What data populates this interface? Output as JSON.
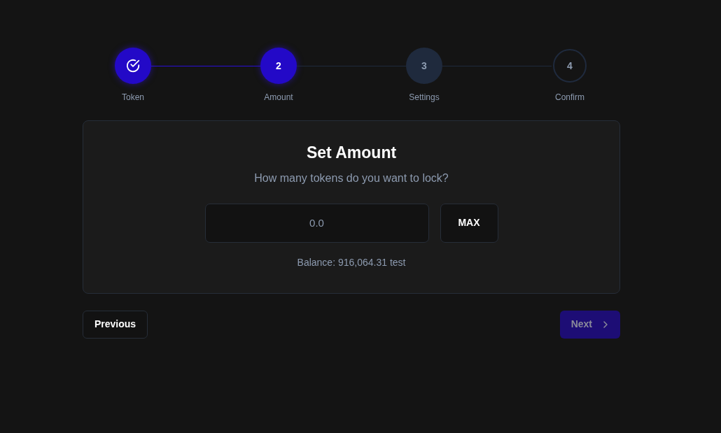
{
  "steps": [
    {
      "label": "Token",
      "kind": "done"
    },
    {
      "label": "Amount",
      "number": "2",
      "kind": "current"
    },
    {
      "label": "Settings",
      "number": "3",
      "kind": "next"
    },
    {
      "label": "Confirm",
      "number": "4",
      "kind": "pending"
    }
  ],
  "card": {
    "title": "Set Amount",
    "subtitle": "How many tokens do you want to lock?",
    "amount_field": {
      "placeholder": "0.0"
    },
    "max_button": "MAX",
    "balance": "Balance: 916,064.31 test"
  },
  "nav": {
    "previous": {
      "label": "Previous",
      "disabled": false
    },
    "next": {
      "label": "Next",
      "disabled": true
    }
  }
}
